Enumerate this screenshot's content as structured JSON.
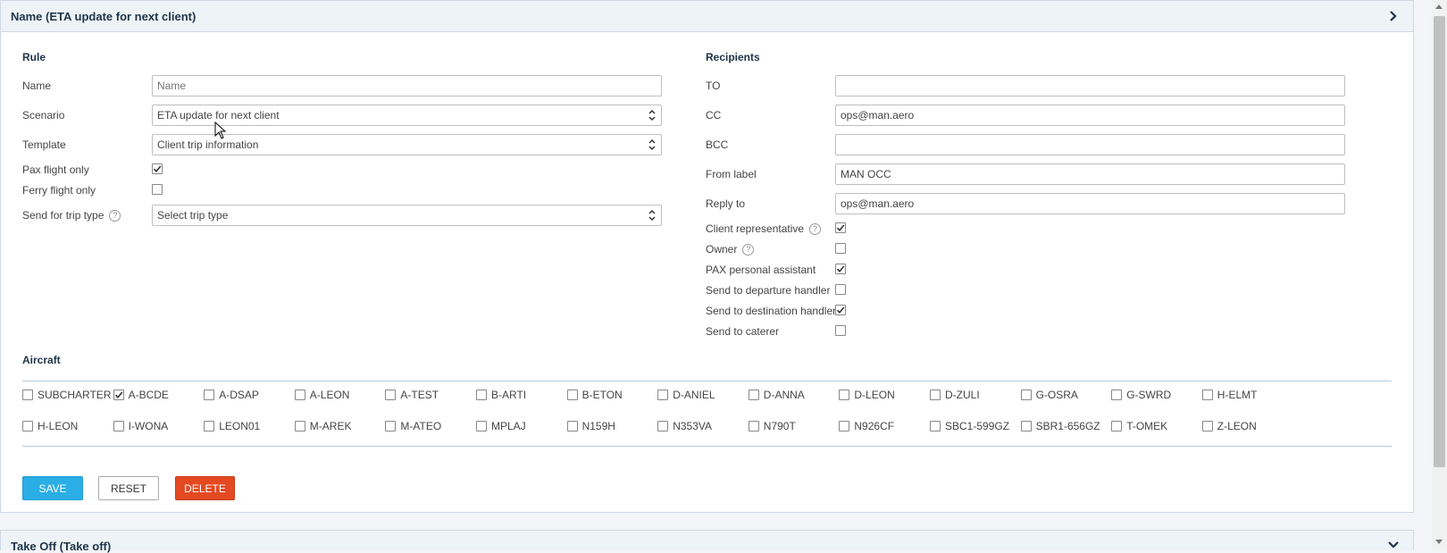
{
  "header": {
    "title": "Name (ETA update for next client)"
  },
  "rule": {
    "title": "Rule",
    "name_label": "Name",
    "name_placeholder": "Name",
    "scenario_label": "Scenario",
    "scenario_value": "ETA update for next client",
    "template_label": "Template",
    "template_value": "Client trip information",
    "pax_label": "Pax flight only",
    "pax_checked": true,
    "ferry_label": "Ferry flight only",
    "ferry_checked": false,
    "trip_type_label": "Send for trip type",
    "trip_type_placeholder": "Select trip type"
  },
  "recipients": {
    "title": "Recipients",
    "to_label": "TO",
    "to_value": "",
    "cc_label": "CC",
    "cc_value": "ops@man.aero",
    "bcc_label": "BCC",
    "bcc_value": "",
    "from_label": "From label",
    "from_value": "MAN OCC",
    "reply_label": "Reply to",
    "reply_value": "ops@man.aero",
    "checks": [
      {
        "label": "Client representative",
        "checked": true,
        "help": true
      },
      {
        "label": "Owner",
        "checked": false,
        "help": true
      },
      {
        "label": "PAX personal assistant",
        "checked": true,
        "help": false
      },
      {
        "label": "Send to departure handler",
        "checked": false,
        "help": false
      },
      {
        "label": "Send to destination handler",
        "checked": true,
        "help": false
      },
      {
        "label": "Send to caterer",
        "checked": false,
        "help": false
      }
    ]
  },
  "aircraft": {
    "title": "Aircraft",
    "items": [
      {
        "label": "SUBCHARTER",
        "checked": false
      },
      {
        "label": "A-BCDE",
        "checked": true
      },
      {
        "label": "A-DSAP",
        "checked": false
      },
      {
        "label": "A-LEON",
        "checked": false
      },
      {
        "label": "A-TEST",
        "checked": false
      },
      {
        "label": "B-ARTI",
        "checked": false
      },
      {
        "label": "B-ETON",
        "checked": false
      },
      {
        "label": "D-ANIEL",
        "checked": false
      },
      {
        "label": "D-ANNA",
        "checked": false
      },
      {
        "label": "D-LEON",
        "checked": false
      },
      {
        "label": "D-ZULI",
        "checked": false
      },
      {
        "label": "G-OSRA",
        "checked": false
      },
      {
        "label": "G-SWRD",
        "checked": false
      },
      {
        "label": "H-ELMT",
        "checked": false
      },
      {
        "label": "H-LEON",
        "checked": false
      },
      {
        "label": "I-WONA",
        "checked": false
      },
      {
        "label": "LEON01",
        "checked": false
      },
      {
        "label": "M-AREK",
        "checked": false
      },
      {
        "label": "M-ATEO",
        "checked": false
      },
      {
        "label": "MPLAJ",
        "checked": false
      },
      {
        "label": "N159H",
        "checked": false
      },
      {
        "label": "N353VA",
        "checked": false
      },
      {
        "label": "N790T",
        "checked": false
      },
      {
        "label": "N926CF",
        "checked": false
      },
      {
        "label": "SBC1-599GZ",
        "checked": false
      },
      {
        "label": "SBR1-656GZ",
        "checked": false
      },
      {
        "label": "T-OMEK",
        "checked": false
      },
      {
        "label": "Z-LEON",
        "checked": false
      }
    ]
  },
  "buttons": {
    "save": "SAVE",
    "reset": "RESET",
    "delete": "DELETE"
  },
  "next_panel": {
    "title": "Take Off (Take off)"
  },
  "colors": {
    "save": "#2aaee5",
    "delete": "#e34a22",
    "title": "#1f3448"
  },
  "icons": {
    "header_chevron": "chevron-right-icon",
    "next_chevron": "chevron-down-icon",
    "help": "question-circle-icon",
    "select": "updown-arrows-icon"
  }
}
